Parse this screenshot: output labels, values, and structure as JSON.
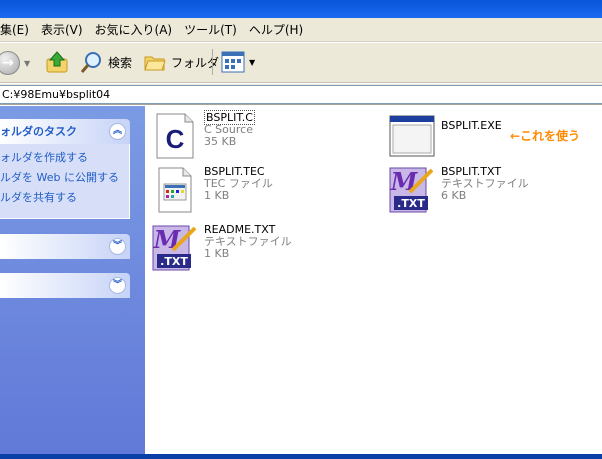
{
  "menu": [
    "集(E)",
    "表示(V)",
    "お気に入り(A)",
    "ツール(T)",
    "ヘルプ(H)"
  ],
  "toolbar": {
    "back_arrow": "←",
    "search_label": "検索",
    "folders_label": "フォルダ"
  },
  "address": {
    "path": "C:¥98Emu¥bsplit04"
  },
  "tasks": {
    "title": "ォルダのタスク",
    "items": [
      "ォルダを作成する",
      "ルダを Web に公開する",
      "ルダを共有する"
    ]
  },
  "files": [
    {
      "name": "BSPLIT.C",
      "type": "C Source",
      "size": "35 KB",
      "icon": "c-source-icon"
    },
    {
      "name": "BSPLIT.EXE",
      "type": "",
      "size": "",
      "icon": "application-window-icon"
    },
    {
      "name": "BSPLIT.TEC",
      "type": "TEC ファイル",
      "size": "1 KB",
      "icon": "tec-file-icon"
    },
    {
      "name": "BSPLIT.TXT",
      "type": "テキストファイル",
      "size": "6 KB",
      "icon": "mifes-text-icon"
    },
    {
      "name": "README.TXT",
      "type": "テキストファイル",
      "size": "1 KB",
      "icon": "mifes-text-icon"
    }
  ],
  "annotation": "←これを使う",
  "colors": {
    "task_link": "#215dc6",
    "annotation": "#ff8a00",
    "pane_blue": "#7b9be4"
  }
}
